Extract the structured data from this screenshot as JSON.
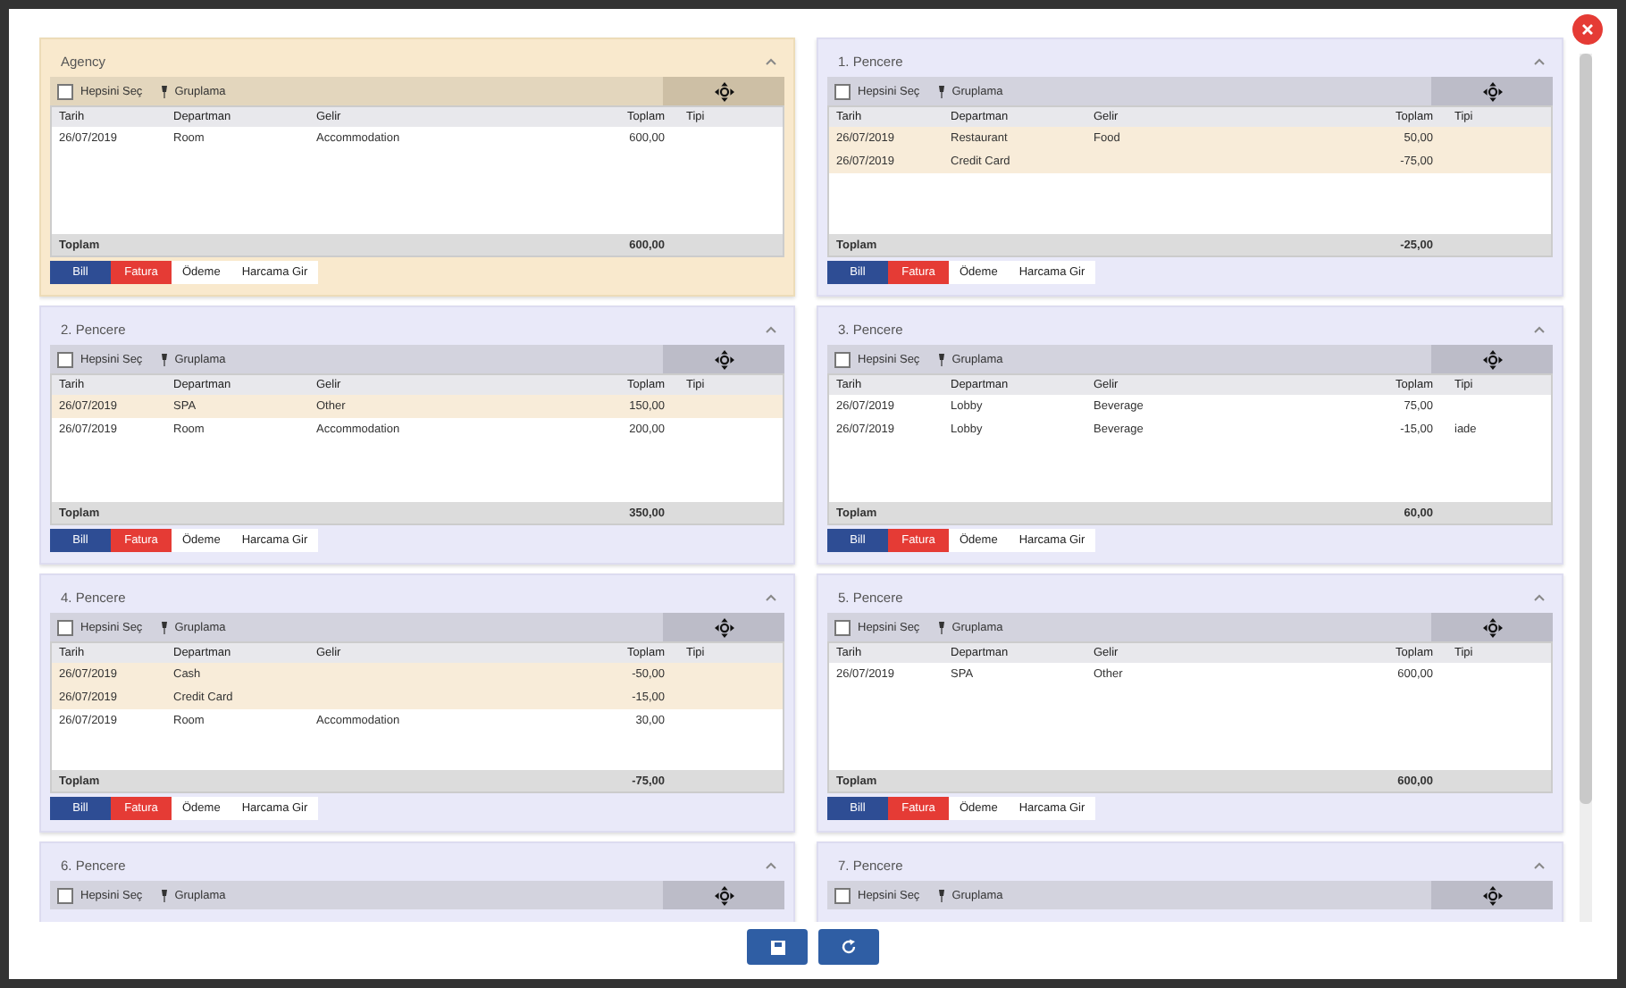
{
  "panels": [
    {
      "title": "Agency",
      "selected": true,
      "select_all": {
        "label": "Hepsini Seç",
        "checked": false
      },
      "grouping": "Gruplama",
      "columns": [
        "Tarih",
        "Departman",
        "Gelir",
        "Toplam",
        "Tipi"
      ],
      "rows": [
        {
          "date": "26/07/2019",
          "department": "Room",
          "income": "Accommodation",
          "amount": "600,00",
          "highlighted": false
        }
      ],
      "total_label": "Toplam",
      "total": "600,00",
      "buttons": [
        {
          "label": "Bill",
          "kind": "primary"
        },
        {
          "label": "Fatura",
          "kind": "danger"
        },
        {
          "label": "Ödeme",
          "kind": "plain"
        },
        {
          "label": "Harcama Gir",
          "kind": "plain"
        }
      ]
    },
    {
      "title": "1. Pencere",
      "selected": false,
      "select_all": {
        "label": "Hepsini Seç",
        "checked": false
      },
      "grouping": "Gruplama",
      "columns": [
        "Tarih",
        "Departman",
        "Gelir",
        "Toplam",
        "Tipi"
      ],
      "rows": [
        {
          "date": "26/07/2019",
          "department": "Restaurant",
          "income": "Food",
          "amount": "50,00",
          "highlighted": true
        },
        {
          "date": "26/07/2019",
          "department": "Credit Card",
          "amount": "-75,00",
          "highlighted": true
        }
      ],
      "total_label": "Toplam",
      "total": "-25,00",
      "buttons": [
        {
          "label": "Bill",
          "kind": "primary"
        },
        {
          "label": "Fatura",
          "kind": "danger"
        },
        {
          "label": "Ödeme",
          "kind": "plain"
        },
        {
          "label": "Harcama Gir",
          "kind": "plain"
        }
      ]
    },
    {
      "title": "2. Pencere",
      "selected": false,
      "select_all": {
        "label": "Hepsini Seç",
        "checked": false
      },
      "grouping": "Gruplama",
      "columns": [
        "Tarih",
        "Departman",
        "Gelir",
        "Toplam",
        "Tipi"
      ],
      "rows": [
        {
          "date": "26/07/2019",
          "department": "SPA",
          "income": "Other",
          "amount": "150,00",
          "highlighted": true
        },
        {
          "date": "26/07/2019",
          "department": "Room",
          "income": "Accommodation",
          "amount": "200,00",
          "highlighted": false
        }
      ],
      "total_label": "Toplam",
      "total": "350,00",
      "buttons": [
        {
          "label": "Bill",
          "kind": "primary"
        },
        {
          "label": "Fatura",
          "kind": "danger"
        },
        {
          "label": "Ödeme",
          "kind": "plain"
        },
        {
          "label": "Harcama Gir",
          "kind": "plain"
        }
      ]
    },
    {
      "title": "3. Pencere",
      "selected": false,
      "select_all": {
        "label": "Hepsini Seç",
        "checked": false
      },
      "grouping": "Gruplama",
      "columns": [
        "Tarih",
        "Departman",
        "Gelir",
        "Toplam",
        "Tipi"
      ],
      "rows": [
        {
          "date": "26/07/2019",
          "department": "Lobby",
          "income": "Beverage",
          "amount": "75,00",
          "highlighted": false
        },
        {
          "date": "26/07/2019",
          "department": "Lobby",
          "income": "Beverage",
          "amount": "-15,00",
          "type": "iade",
          "highlighted": false
        }
      ],
      "total_label": "Toplam",
      "total": "60,00",
      "buttons": [
        {
          "label": "Bill",
          "kind": "primary"
        },
        {
          "label": "Fatura",
          "kind": "danger"
        },
        {
          "label": "Ödeme",
          "kind": "plain"
        },
        {
          "label": "Harcama Gir",
          "kind": "plain"
        }
      ]
    },
    {
      "title": "4. Pencere",
      "selected": false,
      "select_all": {
        "label": "Hepsini Seç",
        "checked": false
      },
      "grouping": "Gruplama",
      "columns": [
        "Tarih",
        "Departman",
        "Gelir",
        "Toplam",
        "Tipi"
      ],
      "rows": [
        {
          "date": "26/07/2019",
          "department": "Cash",
          "amount": "-50,00",
          "highlighted": true
        },
        {
          "date": "26/07/2019",
          "department": "Credit Card",
          "amount": "-15,00",
          "highlighted": true
        },
        {
          "date": "26/07/2019",
          "department": "Room",
          "income": "Accommodation",
          "amount": "30,00",
          "highlighted": false
        }
      ],
      "total_label": "Toplam",
      "total": "-75,00",
      "buttons": [
        {
          "label": "Bill",
          "kind": "primary"
        },
        {
          "label": "Fatura",
          "kind": "danger"
        },
        {
          "label": "Ödeme",
          "kind": "plain"
        },
        {
          "label": "Harcama Gir",
          "kind": "plain"
        }
      ]
    },
    {
      "title": "5. Pencere",
      "selected": false,
      "select_all": {
        "label": "Hepsini Seç",
        "checked": false
      },
      "grouping": "Gruplama",
      "columns": [
        "Tarih",
        "Departman",
        "Gelir",
        "Toplam",
        "Tipi"
      ],
      "rows": [
        {
          "date": "26/07/2019",
          "department": "SPA",
          "income": "Other",
          "amount": "600,00",
          "highlighted": false
        }
      ],
      "total_label": "Toplam",
      "total": "600,00",
      "buttons": [
        {
          "label": "Bill",
          "kind": "primary"
        },
        {
          "label": "Fatura",
          "kind": "danger"
        },
        {
          "label": "Ödeme",
          "kind": "plain"
        },
        {
          "label": "Harcama Gir",
          "kind": "plain"
        }
      ]
    },
    {
      "title": "6. Pencere",
      "selected": false,
      "select_all": {
        "label": "Hepsini Seç",
        "checked": false
      },
      "grouping": "Gruplama"
    },
    {
      "title": "7. Pencere",
      "selected": false,
      "select_all": {
        "label": "Hepsini Seç",
        "checked": false
      },
      "grouping": "Gruplama"
    }
  ]
}
